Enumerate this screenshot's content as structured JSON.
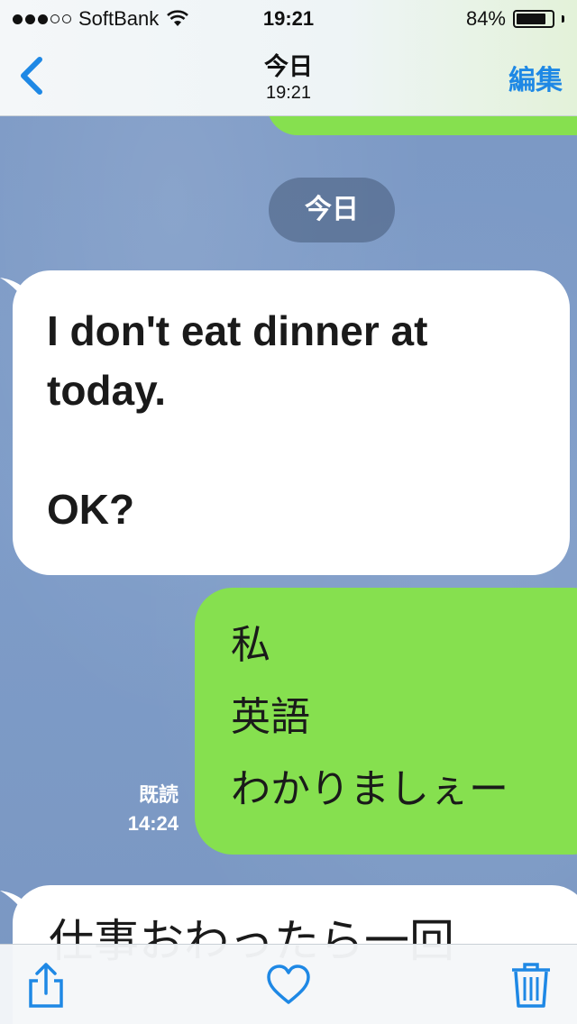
{
  "status_bar": {
    "carrier": "SoftBank",
    "time": "19:21",
    "battery_percent": "84%",
    "signal_bars": 3,
    "signal_max": 5,
    "battery_level": 0.84
  },
  "nav": {
    "title": "今日",
    "subtitle": "19:21",
    "edit_label": "編集",
    "back_icon": "chevron-left-icon"
  },
  "chat": {
    "date_separator": "今日",
    "messages": [
      {
        "direction": "incoming",
        "lines": [
          "I don't eat dinner at",
          "today.",
          "",
          "OK?"
        ]
      },
      {
        "direction": "outgoing",
        "lines": [
          "私",
          "英語",
          "わかりましぇー"
        ],
        "read_label": "既読",
        "time": "14:24"
      },
      {
        "direction": "incoming",
        "lines": [
          "仕事おわったら一回"
        ]
      }
    ]
  },
  "toolbar": {
    "share_icon": "share-icon",
    "like_icon": "heart-icon",
    "delete_icon": "trash-icon"
  },
  "colors": {
    "accent": "#1e88e5",
    "outgoing_bubble": "#86e04f",
    "incoming_bubble": "#ffffff",
    "chat_background": "#7f9cc6"
  }
}
